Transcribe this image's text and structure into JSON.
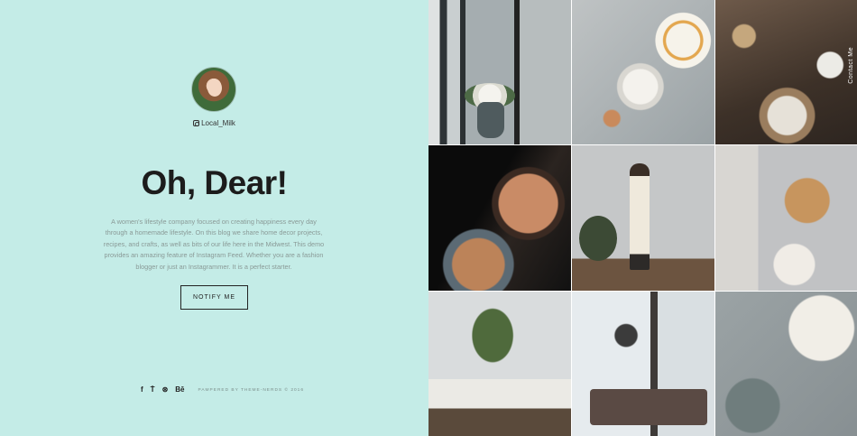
{
  "profile": {
    "handle": "Local_Milk"
  },
  "main": {
    "title": "Oh, Dear!",
    "description": "A women's lifestyle company focused on creating happiness every day through a homemade lifestyle. On this blog we share home decor projects, recipes, and crafts, as well as bits of our life here in the Midwest. This demo provides an amazing feature of Instagram Feed. Whether you are a fashion blogger or just an Instagrammer. It is a perfect starter.",
    "notify_button": "NOTIFY ME"
  },
  "footer": {
    "social_icons": [
      {
        "name": "facebook-icon",
        "glyph": "f"
      },
      {
        "name": "twitter-icon",
        "glyph": "Ṫ"
      },
      {
        "name": "dribbble-icon",
        "glyph": "⊛"
      },
      {
        "name": "behance-icon",
        "glyph": "Bē"
      }
    ],
    "copyright": "PAMPERED BY THEME-NERDS © 2016"
  },
  "gallery": {
    "contact_label": "Contact Me",
    "tiles": [
      "t1",
      "t2",
      "t3",
      "t4",
      "t5",
      "t6",
      "t7",
      "t8",
      "t9"
    ]
  },
  "colors": {
    "background": "#c4ece7",
    "title": "#1c1c1c",
    "description": "#8a9a97"
  }
}
